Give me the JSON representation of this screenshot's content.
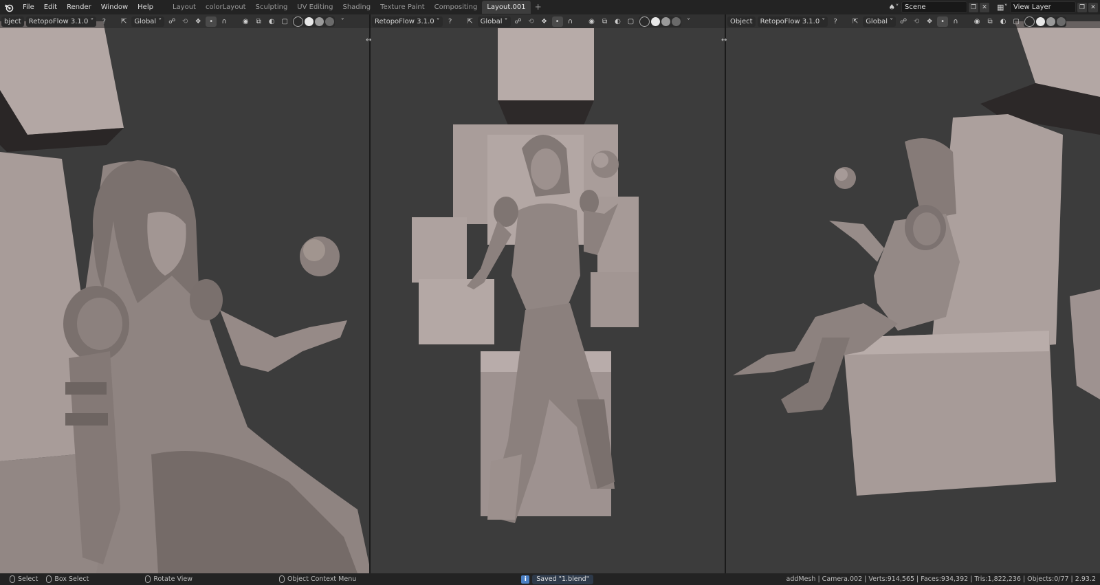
{
  "app": {
    "logo_icon": "blender-logo-icon"
  },
  "menus": [
    "File",
    "Edit",
    "Render",
    "Window",
    "Help"
  ],
  "workspaces": [
    "Layout",
    "colorLayout",
    "Sculpting",
    "UV Editing",
    "Shading",
    "Texture Paint",
    "Compositing",
    "Layout.001"
  ],
  "active_workspace": "Layout.001",
  "add_workspace": "+",
  "scene": {
    "label": "Scene",
    "icon": "scene-icon"
  },
  "view_layer": {
    "label": "View Layer",
    "icon": "view-layer-icon"
  },
  "viewports": [
    {
      "mode_label": "bject",
      "addon_label": "RetopoFlow 3.1.0",
      "help": "?",
      "orientation": "Global"
    },
    {
      "mode_label": "",
      "addon_label": "RetopoFlow 3.1.0",
      "help": "?",
      "orientation": "Global"
    },
    {
      "mode_label": "Object",
      "addon_label": "RetopoFlow 3.1.0",
      "help": "?",
      "orientation": "Global"
    }
  ],
  "statusbar": {
    "select": "Select",
    "box_select": "Box Select",
    "rotate_view": "Rotate View",
    "context_menu": "Object Context Menu",
    "saved": "Saved \"1.blend\"",
    "stats": "addMesh | Camera.002 | Verts:914,565 | Faces:934,392 | Tris:1,822,236 | Objects:0/77 | 2.93.2"
  },
  "colors": {
    "viewport_bg": "#3c3c3c",
    "clay_light": "#b8aca9",
    "clay_mid": "#9b8f8c",
    "clay_dark": "#6e6462",
    "accent_blue": "#4a7fc4"
  }
}
